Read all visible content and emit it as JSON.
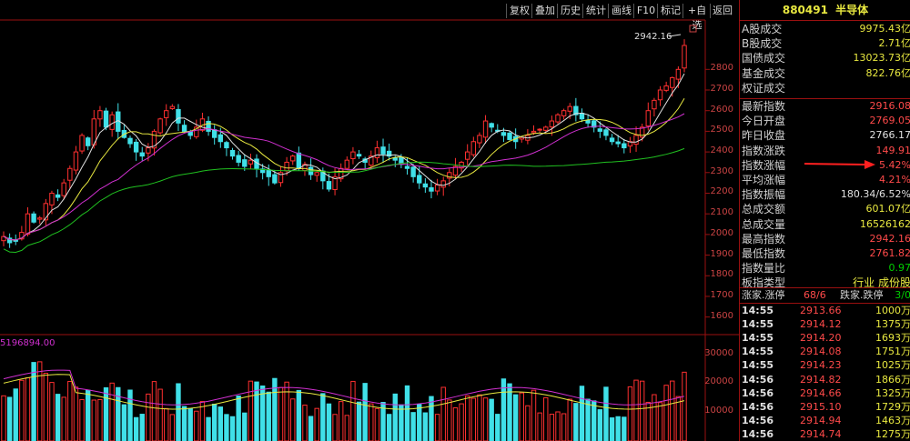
{
  "toolbar": {
    "buttons": [
      "复权",
      "叠加",
      "历史",
      "统计",
      "画线",
      "F10",
      "标记",
      "+自选",
      "返回"
    ]
  },
  "chart": {
    "max_label": "2942.16",
    "price_axis": [
      "2800",
      "2700",
      "2600",
      "2500",
      "2400",
      "2300",
      "2200",
      "2100",
      "2000",
      "1900",
      "1800",
      "1700",
      "1600"
    ],
    "volume_header": "5196894.00",
    "volume_axis": [
      "30000",
      "20000",
      "10000"
    ]
  },
  "chart_data": {
    "type": "candlestick",
    "series": [
      {
        "name": "close",
        "values": [
          1990,
          1960,
          1970,
          2010,
          2100,
          2060,
          2080,
          2150,
          2200,
          2180,
          2250,
          2320,
          2400,
          2480,
          2430,
          2560,
          2600,
          2520,
          2580,
          2500,
          2470,
          2440,
          2400,
          2380,
          2420,
          2500,
          2560,
          2600,
          2620,
          2540,
          2500,
          2480,
          2520,
          2560,
          2500,
          2470,
          2450,
          2420,
          2380,
          2350,
          2330,
          2360,
          2320,
          2300,
          2280,
          2250,
          2300,
          2350,
          2380,
          2320,
          2340,
          2290,
          2300,
          2260,
          2220,
          2280,
          2320,
          2360,
          2400,
          2380,
          2350,
          2380,
          2420,
          2390,
          2380,
          2360,
          2340,
          2320,
          2280,
          2250,
          2230,
          2210,
          2240,
          2260,
          2300,
          2330,
          2350,
          2400,
          2450,
          2480,
          2550,
          2520,
          2500,
          2480,
          2460,
          2450,
          2470,
          2480,
          2500,
          2510,
          2520,
          2550,
          2580,
          2600,
          2620,
          2580,
          2560,
          2540,
          2520,
          2500,
          2480,
          2450,
          2440,
          2420,
          2450,
          2480,
          2520,
          2600,
          2650,
          2700,
          2720,
          2760,
          2800,
          2916
        ]
      }
    ],
    "ylim": [
      1550,
      2960
    ],
    "volume_ylim": [
      0,
      33000
    ]
  },
  "panel": {
    "header_code": "880491",
    "header_name": "半导体",
    "rows": [
      {
        "label": "A股成交",
        "value": "9975.43亿",
        "color": "#e8e840"
      },
      {
        "label": "B股成交",
        "value": "2.71亿",
        "color": "#e8e840"
      },
      {
        "label": "国债成交",
        "value": "13023.73亿",
        "color": "#e8e840"
      },
      {
        "label": "基金成交",
        "value": "822.76亿",
        "color": "#e8e840"
      },
      {
        "label": "权证成交",
        "value": "",
        "color": "#e8e840"
      },
      {
        "label": "最新指数",
        "value": "2916.08",
        "color": "#ff4a4a"
      },
      {
        "label": "今日开盘",
        "value": "2769.05",
        "color": "#ff4a4a"
      },
      {
        "label": "昨日收盘",
        "value": "2766.17",
        "color": "#e0e0e0"
      },
      {
        "label": "指数涨跌",
        "value": "149.91",
        "color": "#ff4a4a"
      },
      {
        "label": "指数涨幅",
        "value": "5.42%",
        "color": "#ff4a4a"
      },
      {
        "label": "平均涨幅",
        "value": "4.21%",
        "color": "#ff4a4a"
      },
      {
        "label": "指数振幅",
        "value": "180.34/6.52%",
        "color": "#e0e0e0"
      },
      {
        "label": "总成交额",
        "value": "601.07亿",
        "color": "#e8e840"
      },
      {
        "label": "总成交量",
        "value": "16526162",
        "color": "#e8e840"
      },
      {
        "label": "最高指数",
        "value": "2942.16",
        "color": "#ff4a4a"
      },
      {
        "label": "最低指数",
        "value": "2761.82",
        "color": "#ff4a4a"
      },
      {
        "label": "指数量比",
        "value": "0.97",
        "color": "#00d000"
      },
      {
        "label": "板指类型",
        "value": "行业 成份股",
        "color": "#e8e840"
      }
    ],
    "rise_fall": {
      "label1": "涨家.涨停",
      "value1": "68/6",
      "label2": "跌家.跌停",
      "value2": "3/0"
    },
    "ticks": [
      {
        "time": "14:55",
        "price": "2913.66",
        "vol": "1000万"
      },
      {
        "time": "14:55",
        "price": "2914.12",
        "vol": "1375万"
      },
      {
        "time": "14:55",
        "price": "2914.20",
        "vol": "1693万"
      },
      {
        "time": "14:55",
        "price": "2914.08",
        "vol": "1751万"
      },
      {
        "time": "14:55",
        "price": "2914.23",
        "vol": "1025万"
      },
      {
        "time": "14:56",
        "price": "2914.82",
        "vol": "1866万"
      },
      {
        "time": "14:56",
        "price": "2914.66",
        "vol": "1325万"
      },
      {
        "time": "14:56",
        "price": "2915.10",
        "vol": "1729万"
      },
      {
        "time": "14:56",
        "price": "2914.94",
        "vol": "1463万"
      },
      {
        "time": "14:56",
        "price": "2914.74",
        "vol": "1275万"
      }
    ]
  },
  "colors": {
    "up": "#ff3030",
    "down": "#40e0e8",
    "ma5": "#e0e0e0",
    "ma10": "#e8e840",
    "ma20": "#d030d0",
    "ma60": "#20c020"
  }
}
